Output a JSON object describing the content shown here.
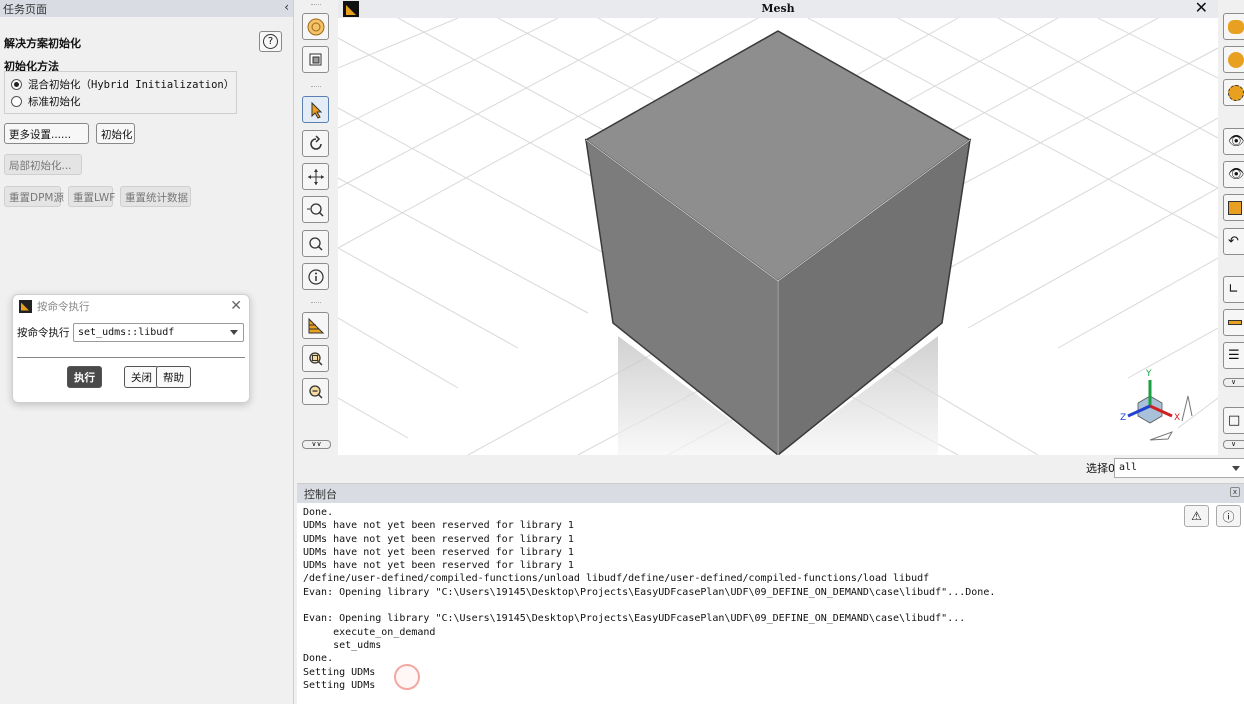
{
  "task_panel": {
    "header": "任务页面",
    "collapse_glyph": "‹",
    "title": "解决方案初始化",
    "help_glyph": "?",
    "method_label": "初始化方法",
    "method_options": [
      {
        "label": "混合初始化（Hybrid Initialization）",
        "selected": true
      },
      {
        "label": "标准初始化",
        "selected": false
      }
    ],
    "buttons": {
      "more_settings": "更多设置......",
      "initialize": "初始化",
      "patch": "局部初始化...",
      "reset_dpm": "重置DPM源",
      "reset_lwf": "重置LWF",
      "reset_stats": "重置统计数据"
    }
  },
  "command_dialog": {
    "title": "按命令执行",
    "close_glyph": "✕",
    "field_label": "按命令执行",
    "selected_command": "set_udms::libudf",
    "buttons": {
      "execute": "执行",
      "close": "关闭",
      "help": "帮助"
    }
  },
  "graphics": {
    "title": "Mesh",
    "close_glyph": "✕",
    "axes": {
      "x": "X",
      "y": "Y",
      "z": "Z"
    },
    "colors": {
      "cube_front": "#7d7d7d",
      "cube_top": "#8e8e8e",
      "cube_side": "#6f6f6f",
      "grid": "#d9d9d9"
    }
  },
  "toolbar_icons": [
    "fit-icon",
    "view-icon",
    "select-pointer-icon",
    "rotate-icon",
    "pan-icon",
    "zoom-in-out-icon",
    "zoom-icon",
    "info-icon",
    "orient-icon",
    "zoom-box-icon",
    "zoom-out-icon"
  ],
  "selection": {
    "label": "选择0",
    "value": "all"
  },
  "console": {
    "title": "控制台",
    "lines": [
      "Done.",
      "UDMs have not yet been reserved for library 1",
      "UDMs have not yet been reserved for library 1",
      "UDMs have not yet been reserved for library 1",
      "UDMs have not yet been reserved for library 1",
      "/define/user-defined/compiled-functions/unload libudf/define/user-defined/compiled-functions/load libudf",
      "Evan: Opening library \"C:\\Users\\19145\\Desktop\\Projects\\EasyUDFcasePlan\\UDF\\09_DEFINE_ON_DEMAND\\case\\libudf\"...Done.",
      "",
      "Evan: Opening library \"C:\\Users\\19145\\Desktop\\Projects\\EasyUDFcasePlan\\UDF\\09_DEFINE_ON_DEMAND\\case\\libudf\"...",
      "     execute_on_demand",
      "     set_udms",
      "Done.",
      "Setting UDMs",
      "Setting UDMs"
    ]
  }
}
